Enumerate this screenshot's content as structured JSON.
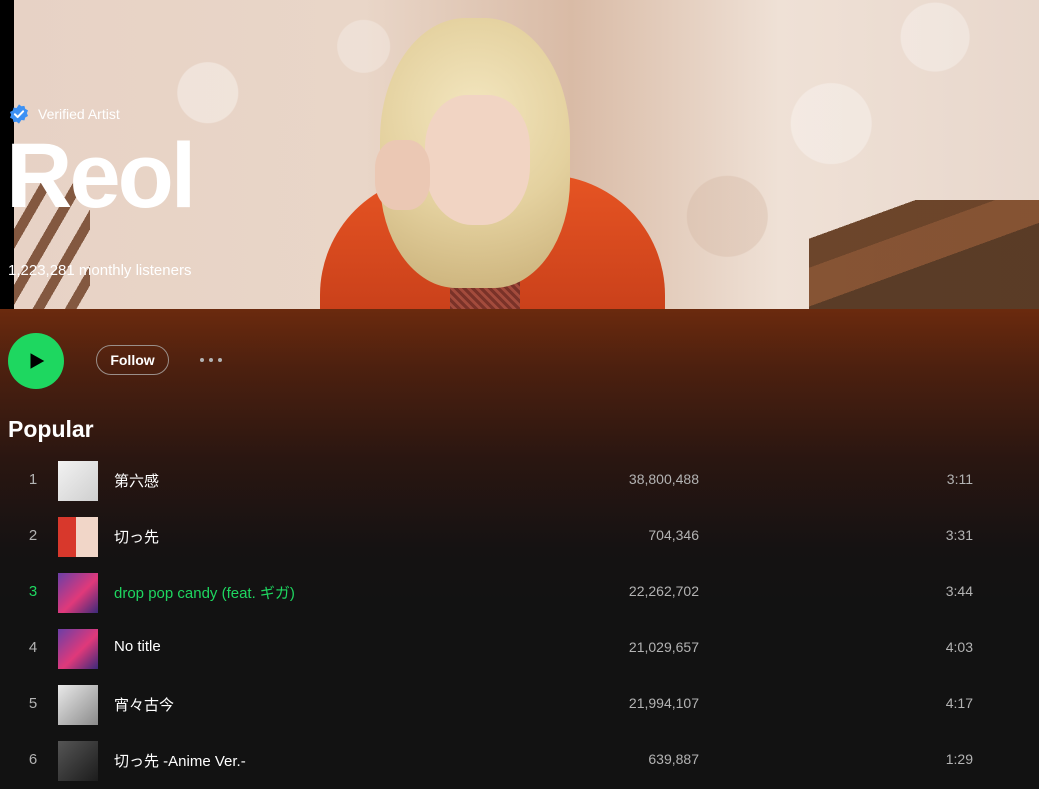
{
  "artist": {
    "verified_label": "Verified Artist",
    "name": "Reol",
    "monthly_listeners": "1,223,281 monthly listeners"
  },
  "controls": {
    "play_icon": "play-icon",
    "follow_label": "Follow",
    "more_icon": "more-options-icon"
  },
  "popular": {
    "title": "Popular",
    "tracks": [
      {
        "num": "1",
        "title": "第六感",
        "plays": "38,800,488",
        "duration": "3:11"
      },
      {
        "num": "2",
        "title": "切っ先",
        "plays": "704,346",
        "duration": "3:31"
      },
      {
        "num": "3",
        "title": "drop pop candy (feat. ギガ)",
        "plays": "22,262,702",
        "duration": "3:44",
        "active": true
      },
      {
        "num": "4",
        "title": "No title",
        "plays": "21,029,657",
        "duration": "4:03"
      },
      {
        "num": "5",
        "title": "宵々古今",
        "plays": "21,994,107",
        "duration": "4:17"
      },
      {
        "num": "6",
        "title": "切っ先 -Anime Ver.-",
        "plays": "639,887",
        "duration": "1:29"
      }
    ]
  },
  "colors": {
    "accent": "#1ed760",
    "verified_badge": "#3d91f4",
    "background": "#121212",
    "header_band": "#6b2a0e"
  }
}
